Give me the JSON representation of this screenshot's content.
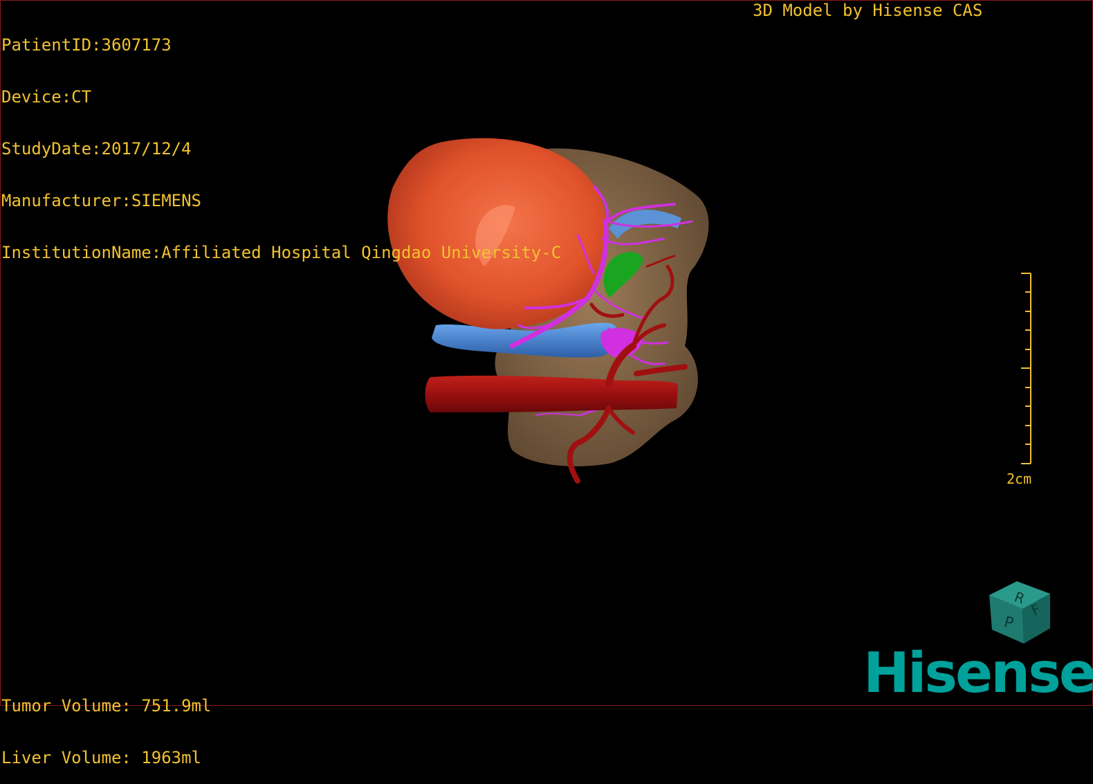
{
  "overlay_top_left": {
    "patient_id": "PatientID:3607173",
    "device": "Device:CT",
    "study_date": "StudyDate:2017/12/4",
    "manufacturer": "Manufacturer:SIEMENS",
    "institution": "InstitutionName:Affiliated Hospital Qingdao University-C"
  },
  "overlay_top_right": {
    "model_by": "3D Model by Hisense CAS"
  },
  "overlay_bottom_left": {
    "tumor_volume": "Tumor Volume: 751.9ml",
    "liver_volume": "Liver Volume: 1963ml"
  },
  "scale_bar": {
    "label": "2cm"
  },
  "orientation_cube": {
    "faces": [
      "R",
      "F",
      "P"
    ],
    "color": "#1f7a70"
  },
  "logo": {
    "text": "Hisense",
    "color": "#00a19a"
  },
  "colors": {
    "overlay_text": "#f2c230",
    "liver": "#8a6a4a",
    "tumor": "#e0522a",
    "hepatic_veins": "#d030e0",
    "portal_vein": "#4a8ad8",
    "artery": "#a01010",
    "gallbladder": "#1aa520"
  }
}
